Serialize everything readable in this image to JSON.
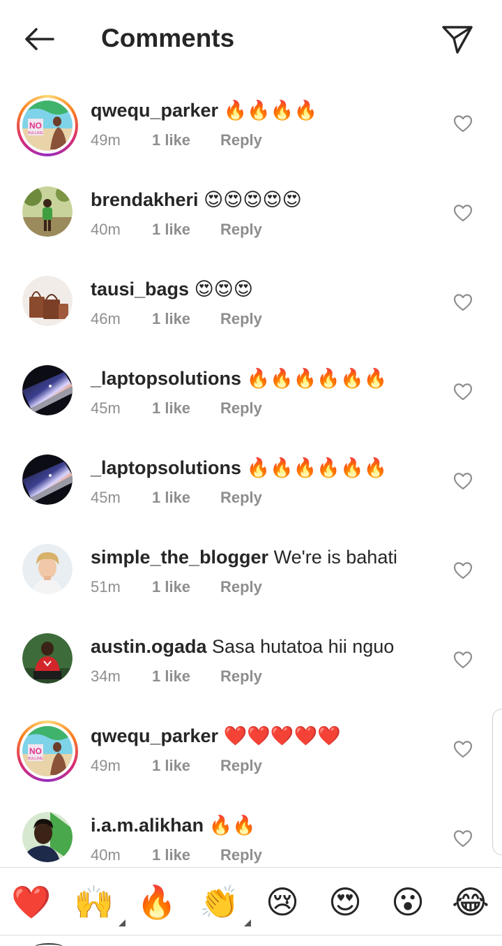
{
  "header": {
    "title": "Comments",
    "back_icon": "arrow-left-icon",
    "send_icon": "paper-plane-icon"
  },
  "comments": [
    {
      "username": "qwequ_parker",
      "text": "🔥🔥🔥🔥",
      "time": "49m",
      "likes": "1 like",
      "reply": "Reply",
      "avatar": "avatar-no-bullying",
      "story_ring": true
    },
    {
      "username": "brendakheri",
      "text": "😍😍😍😍😍",
      "time": "40m",
      "likes": "1 like",
      "reply": "Reply",
      "avatar": "avatar-child-outdoors",
      "story_ring": false
    },
    {
      "username": "tausi_bags",
      "text": "😍😍😍",
      "time": "46m",
      "likes": "1 like",
      "reply": "Reply",
      "avatar": "avatar-handbags",
      "story_ring": false
    },
    {
      "username": "_laptopsolutions",
      "text": "🔥🔥🔥🔥🔥🔥",
      "time": "45m",
      "likes": "1 like",
      "reply": "Reply",
      "avatar": "avatar-laptop",
      "story_ring": false
    },
    {
      "username": "_laptopsolutions",
      "text": "🔥🔥🔥🔥🔥🔥",
      "time": "45m",
      "likes": "1 like",
      "reply": "Reply",
      "avatar": "avatar-laptop",
      "story_ring": false
    },
    {
      "username": "simple_the_blogger",
      "text": "We're is bahati",
      "time": "51m",
      "likes": "1 like",
      "reply": "Reply",
      "avatar": "avatar-blond-boy",
      "story_ring": false
    },
    {
      "username": "austin.ogada",
      "text": "Sasa hutatoa hii nguo",
      "time": "34m",
      "likes": "1 like",
      "reply": "Reply",
      "avatar": "avatar-red-shirt",
      "story_ring": false
    },
    {
      "username": "qwequ_parker",
      "text": "❤️❤️❤️❤️❤️",
      "time": "49m",
      "likes": "1 like",
      "reply": "Reply",
      "avatar": "avatar-no-bullying",
      "story_ring": true
    },
    {
      "username": "i.a.m.alikhan",
      "text": "🔥🔥",
      "time": "40m",
      "likes": "1 like",
      "reply": "Reply",
      "avatar": "avatar-man-portrait",
      "story_ring": false
    }
  ],
  "emoji_bar": [
    {
      "emoji": "❤️",
      "name": "red-heart",
      "has_variants": false
    },
    {
      "emoji": "🙌",
      "name": "raising-hands",
      "has_variants": true
    },
    {
      "emoji": "🔥",
      "name": "fire",
      "has_variants": false
    },
    {
      "emoji": "👏",
      "name": "clapping-hands",
      "has_variants": true
    },
    {
      "emoji": "😢",
      "name": "crying-face",
      "has_variants": false
    },
    {
      "emoji": "😍",
      "name": "heart-eyes",
      "has_variants": false
    },
    {
      "emoji": "😮",
      "name": "open-mouth",
      "has_variants": false
    },
    {
      "emoji": "😂",
      "name": "tears-of-joy",
      "has_variants": false
    }
  ],
  "colors": {
    "text": "#262626",
    "meta": "#8e8e8e",
    "divider": "#dbdbdb",
    "ring_start": "#feda75",
    "ring_end": "#962fbf"
  }
}
